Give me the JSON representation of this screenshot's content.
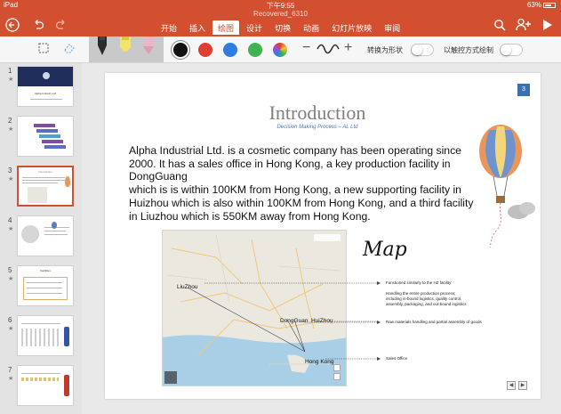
{
  "status": {
    "device": "iPad",
    "time": "下午9:55",
    "battery": "63%"
  },
  "doc_title": "Recovered_6310",
  "tabs": [
    {
      "label": "开始",
      "active": false
    },
    {
      "label": "插入",
      "active": false
    },
    {
      "label": "绘图",
      "active": true
    },
    {
      "label": "设计",
      "active": false
    },
    {
      "label": "切换",
      "active": false
    },
    {
      "label": "动画",
      "active": false
    },
    {
      "label": "幻灯片放映",
      "active": false
    },
    {
      "label": "审阅",
      "active": false
    }
  ],
  "icons": {
    "back": "back-arrow-icon",
    "undo": "undo-icon",
    "redo": "redo-icon",
    "search": "search-icon",
    "add_user": "add-user-icon",
    "play": "play-icon",
    "lasso": "lasso-select-icon",
    "eraser": "eraser-icon"
  },
  "draw_toolbar": {
    "colors": [
      "#111111",
      "#e03c31",
      "#2f7de1",
      "#3fb34f",
      "rainbow"
    ],
    "minus_label": "−",
    "plus_label": "+",
    "convert_label": "转换为形状",
    "touch_label": "以触控方式绘制"
  },
  "accent_color": "#d2502f",
  "thumbnails": [
    {
      "num": "1",
      "title": "Alpha Industry Ltd"
    },
    {
      "num": "2",
      "title": ""
    },
    {
      "num": "3",
      "title": "Introduction",
      "selected": true
    },
    {
      "num": "4",
      "title": ""
    },
    {
      "num": "5",
      "title": "Facilities"
    },
    {
      "num": "6",
      "title": ""
    },
    {
      "num": "7",
      "title": ""
    }
  ],
  "slide": {
    "page_number": "3",
    "title": "Introduction",
    "subtitle": "Decision Making Process – AL Ltd",
    "body_lines": [
      "Alpha Industrial Ltd. is a cosmetic company has been operating since",
      "2000. It has a sales office in Hong Kong, a key production facility in",
      "DongGuang",
      "which is is within 100KM from Hong Kong, a new supporting facility in",
      "Huizhou which is also within 100KM from Hong Kong, and a third facility",
      "in Liuzhou which is 550KM away from Hong Kong."
    ],
    "map_cities": {
      "liuzhou": "LiuZhou",
      "dongguan": "DongGuan",
      "huizhou": "HuiZhou",
      "hongkong": "Hong Kong"
    },
    "annotations": {
      "liuzhou": "Functioned similarly to the HZ facility",
      "dongguan": [
        "Handling the entire production process;",
        "including in-bound logistics, quality control,",
        "assembly, packaging, and out-bound logistics"
      ],
      "huizhou": "Raw materials handling and partial assembly of goods",
      "hongkong": "Sales Office"
    },
    "handwriting": "Map"
  }
}
